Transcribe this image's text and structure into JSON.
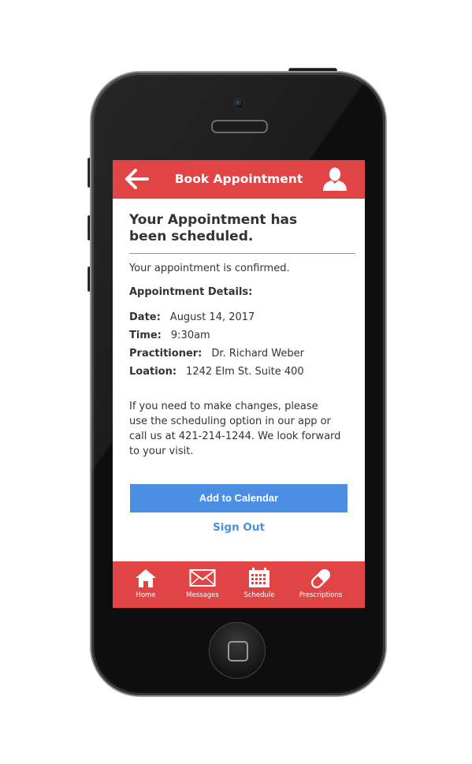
{
  "header": {
    "title": "Book Appointment",
    "back_icon": "arrow-left-icon",
    "profile_icon": "user-icon"
  },
  "confirmation": {
    "title_line1": "Your Appointment has",
    "title_line2": "been scheduled.",
    "confirmed_text": "Your appointment is confirmed.",
    "details_heading": "Appointment Details:",
    "details": [
      {
        "label": "Date:",
        "value": "August 14, 2017"
      },
      {
        "label": "Time:",
        "value": "9:30am"
      },
      {
        "label": "Practitioner:",
        "value": "Dr. Richard Weber"
      },
      {
        "label": "Loation:",
        "value": "1242 Elm St. Suite 400"
      }
    ],
    "notice_line1": "If you need to make changes, please",
    "notice_line2": "use the scheduling option in our app or",
    "notice_line3": "call us at 421-214-1244.  We look forward",
    "notice_line4": "to your visit."
  },
  "actions": {
    "add_to_calendar": "Add to Calendar",
    "sign_out": "Sign Out"
  },
  "tabbar": {
    "items": [
      {
        "label": "Home",
        "icon": "home-icon"
      },
      {
        "label": "Messages",
        "icon": "envelope-icon"
      },
      {
        "label": "Schedule",
        "icon": "calendar-icon"
      },
      {
        "label": "Prescriptions",
        "icon": "pill-icon"
      }
    ]
  },
  "colors": {
    "accent_red": "#e04444",
    "button_blue": "#4a8fe3",
    "text": "#333333"
  }
}
